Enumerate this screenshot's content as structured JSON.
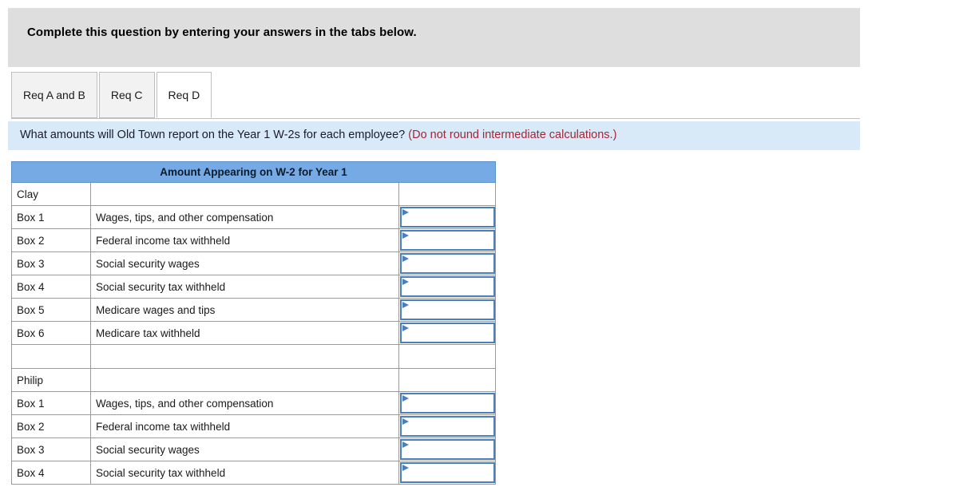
{
  "banner": {
    "instruction": "Complete this question by entering your answers in the tabs below."
  },
  "tabs": [
    {
      "label": "Req A and B",
      "active": false
    },
    {
      "label": "Req C",
      "active": false
    },
    {
      "label": "Req D",
      "active": true
    }
  ],
  "question": {
    "main": "What amounts will Old Town report on the Year 1 W-2s for each employee?",
    "note": "(Do not round intermediate calculations.)"
  },
  "table": {
    "title": "Amount Appearing on W-2 for Year 1",
    "rows": [
      {
        "box": "Clay",
        "description": "",
        "input": false,
        "value": ""
      },
      {
        "box": "Box 1",
        "description": "Wages, tips, and other compensation",
        "input": true,
        "value": ""
      },
      {
        "box": "Box 2",
        "description": "Federal income tax withheld",
        "input": true,
        "value": ""
      },
      {
        "box": "Box 3",
        "description": "Social security wages",
        "input": true,
        "value": ""
      },
      {
        "box": "Box 4",
        "description": "Social security tax withheld",
        "input": true,
        "value": ""
      },
      {
        "box": "Box 5",
        "description": "Medicare wages and tips",
        "input": true,
        "value": ""
      },
      {
        "box": "Box 6",
        "description": "Medicare tax withheld",
        "input": true,
        "value": ""
      },
      {
        "box": "",
        "description": "",
        "input": false,
        "value": ""
      },
      {
        "box": "Philip",
        "description": "",
        "input": false,
        "value": ""
      },
      {
        "box": "Box 1",
        "description": "Wages, tips, and other compensation",
        "input": true,
        "value": ""
      },
      {
        "box": "Box 2",
        "description": "Federal income tax withheld",
        "input": true,
        "value": ""
      },
      {
        "box": "Box 3",
        "description": "Social security wages",
        "input": true,
        "value": ""
      },
      {
        "box": "Box 4",
        "description": "Social security tax withheld",
        "input": true,
        "value": ""
      }
    ]
  },
  "colors": {
    "banner_gray": "#dedede",
    "question_blue": "#d8eaf8",
    "table_header_blue": "#76aae4",
    "note_red": "#a32638",
    "input_border_blue": "#4a7ebc"
  }
}
